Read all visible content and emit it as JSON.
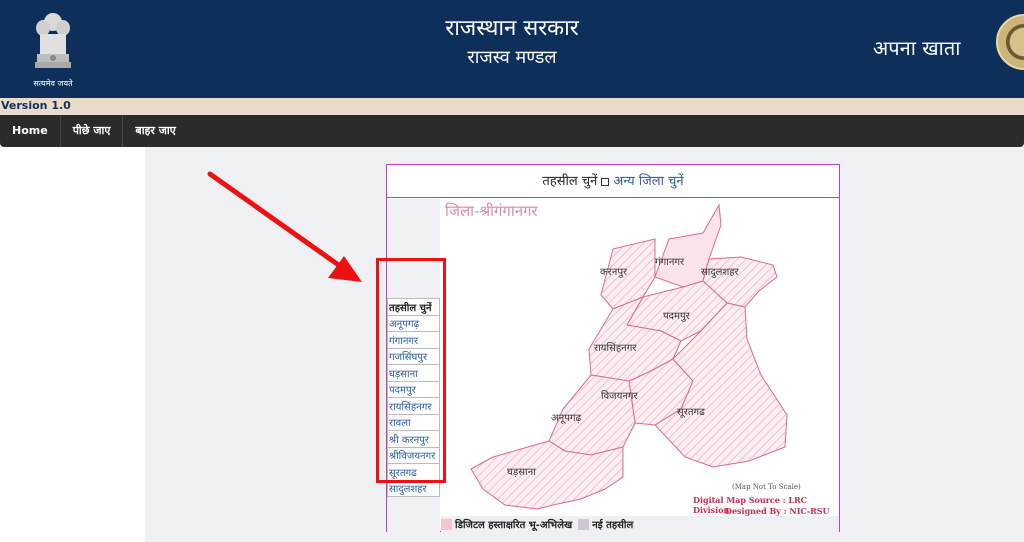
{
  "header": {
    "title": "राजस्थान सरकार",
    "subtitle": "राजस्व मण्डल",
    "app_name": "अपना खाता",
    "emblem_motto": "सत्यमेव जयते"
  },
  "version": "Version 1.0",
  "nav": [
    "Home",
    "पीछे जाए",
    "बाहर जाए"
  ],
  "panel": {
    "heading_text": "तहसील चुनें",
    "heading_link": "अन्य जिला चुनें",
    "district_title": "जिला-श्रीगंगानगर",
    "tehsil_header": "तहसील चुनें",
    "tehsils": [
      "अनूपगढ़",
      "गंगानगर",
      "गजसिंघपुर",
      "घड़साना",
      "पदमपुर",
      "रायसिंहनगर",
      "रावला",
      "श्री करनपुर",
      "श्रीविजयनगर",
      "सूरतगढ",
      "सादुलशहर"
    ],
    "map_labels": [
      "करनपुर",
      "गंगानगर",
      "सादुलशहर",
      "पदमपुर",
      "रायसिंहनगर",
      "विजयनगर",
      "अनूपगढ़",
      "सूरतगढ",
      "घड़साना"
    ],
    "map_note": "(Map Not To Scale)",
    "map_source": "Digital Map Source : LRC Division",
    "map_designer": "Designed By : NIC-RSU",
    "legend": [
      "डिजिटल हस्ताक्षरित भू-अभिलेख",
      "नई तहसील"
    ]
  },
  "colors": {
    "header_bg": "#0f2f5b",
    "nav_bg": "#2b2b2b",
    "panel_border": "#c040c0",
    "map_fill": "#fbe3ea",
    "map_stroke": "#e06a84",
    "legend_digital": "#f6c6d0",
    "legend_new": "#cfc7d6",
    "annotation_arrow": "#ee1111"
  }
}
